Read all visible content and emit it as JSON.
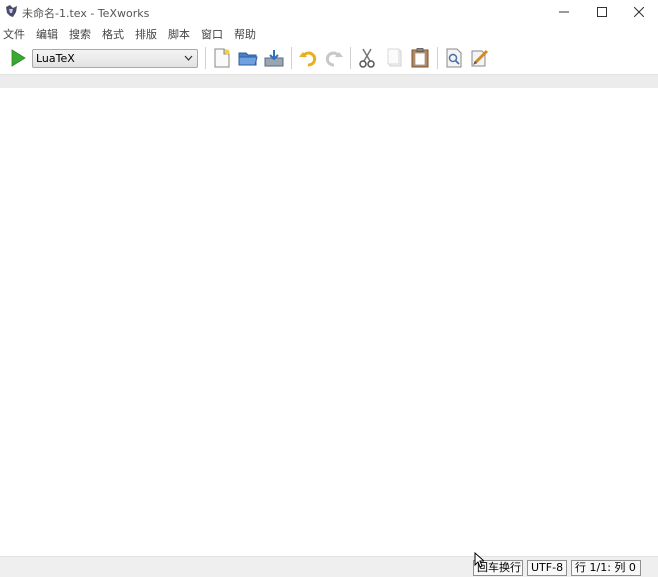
{
  "window": {
    "title": "未命名-1.tex - TeXworks"
  },
  "menu": {
    "items": [
      "文件",
      "编辑",
      "搜索",
      "格式",
      "排版",
      "脚本",
      "窗口",
      "帮助"
    ]
  },
  "toolbar": {
    "engine": "LuaTeX",
    "icons": [
      "typeset-icon",
      "new-file-icon",
      "open-folder-icon",
      "save-icon",
      "undo-icon",
      "redo-icon",
      "cut-icon",
      "copy-icon",
      "paste-icon",
      "preview-icon",
      "edit-pen-icon"
    ],
    "colors": {
      "run_green": "#3aa832",
      "undo_yellow": "#e8b020"
    }
  },
  "status": {
    "line_ending": "回车换行",
    "encoding": "UTF-8",
    "position": "行 1/1: 列 0"
  }
}
